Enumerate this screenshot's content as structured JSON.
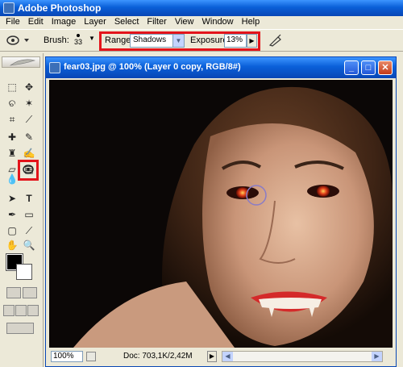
{
  "app": {
    "title": "Adobe Photoshop"
  },
  "menu": [
    "File",
    "Edit",
    "Image",
    "Layer",
    "Select",
    "Filter",
    "View",
    "Window",
    "Help"
  ],
  "options": {
    "brush_label": "Brush:",
    "brush_size": "33",
    "range_label": "Range:",
    "range_value": "Shadows",
    "exposure_label": "Exposure:",
    "exposure_value": "13%"
  },
  "document": {
    "title": "fear03.jpg @ 100% (Layer 0 copy, RGB/8#)",
    "zoom": "100%",
    "doc_info": "Doc: 703,1K/2,42M",
    "minimize_label": "_",
    "maximize_label": "□",
    "close_label": "✕"
  },
  "colors": {
    "highlight": "#e3141b",
    "titlebar": "#0a5fd8",
    "foreground": "#000000",
    "background": "#ffffff"
  }
}
